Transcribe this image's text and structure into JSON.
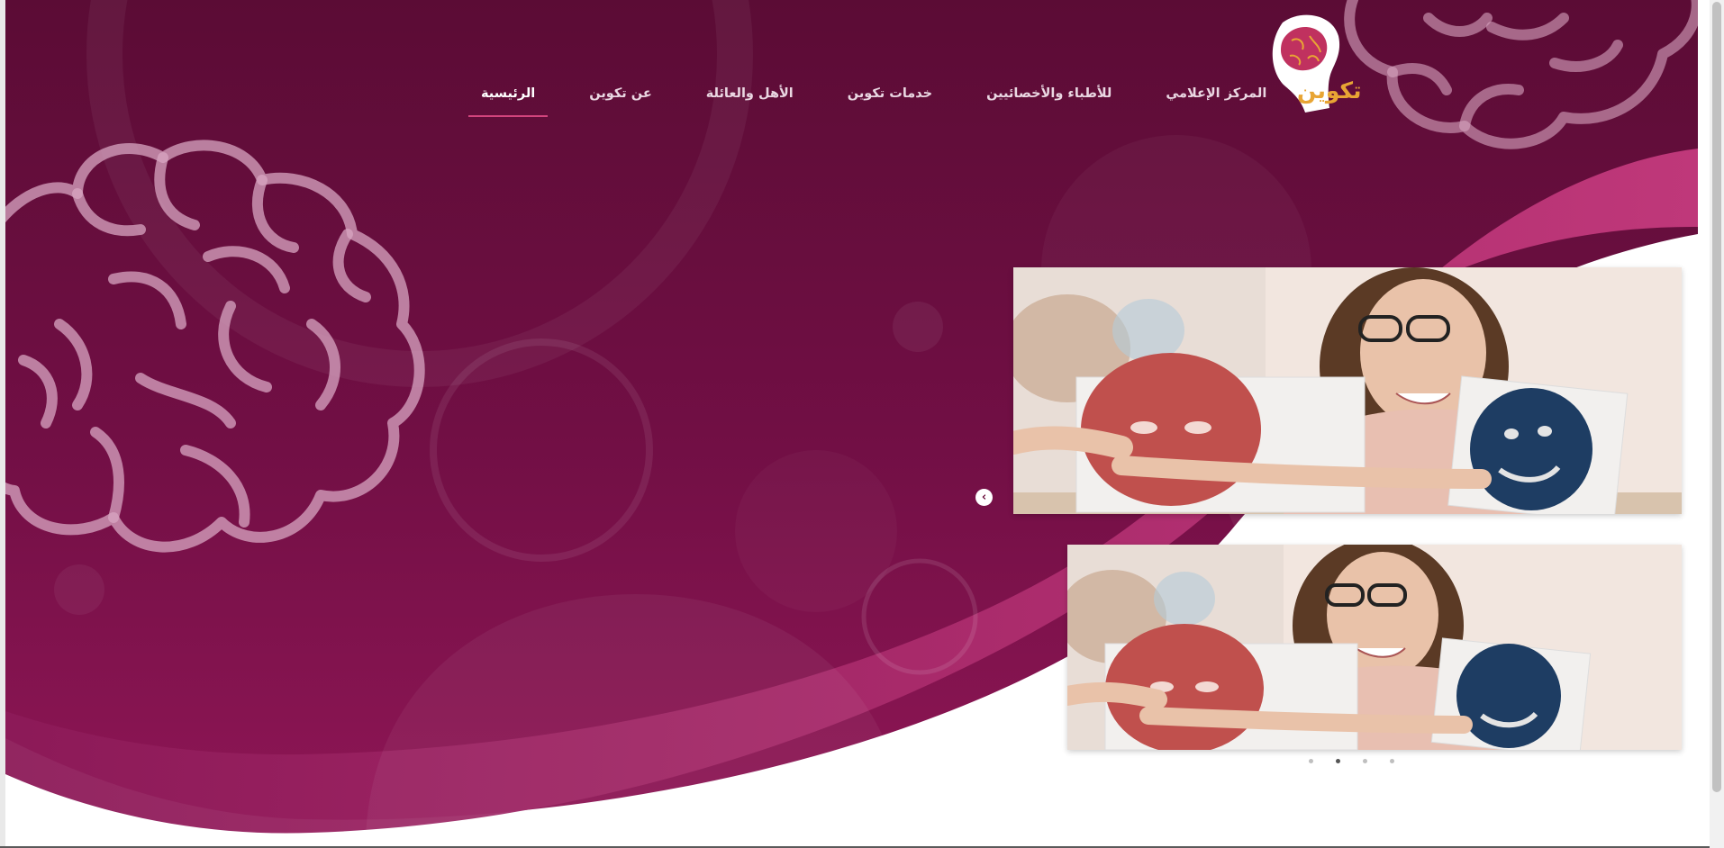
{
  "brand": {
    "name": "تكوين",
    "primary_color": "#6b0f3d",
    "accent_color": "#d2457d",
    "logo_text_color": "#e8a534"
  },
  "nav": {
    "items": [
      {
        "label": "الرئيسية",
        "active": true
      },
      {
        "label": "عن تكوين",
        "active": false
      },
      {
        "label": "الأهل والعائلة",
        "active": false
      },
      {
        "label": "خدمات تكوين",
        "active": false
      },
      {
        "label": "للأطباء والأخصائيين",
        "active": false
      },
      {
        "label": "المركز الإعلامي",
        "active": false
      }
    ]
  },
  "carousel": {
    "prev_icon": "chevron-left-icon",
    "dot_count": 4,
    "active_dot": 2
  }
}
